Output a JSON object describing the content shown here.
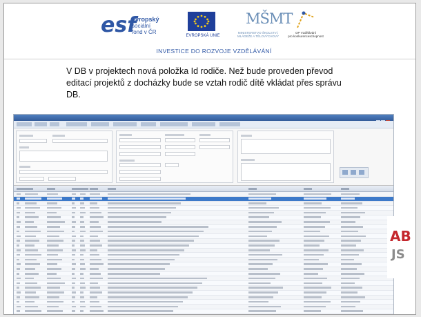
{
  "logos": {
    "esf_mark": "esf",
    "esf_line1": "evropský",
    "esf_line2": "sociální",
    "esf_line3": "fond v ČR",
    "eu_caption": "EVROPSKÁ UNIE",
    "msmt_mark": "MŠMT",
    "msmt_caption_1": "MINISTERSTVO ŠKOLSTVÍ,",
    "msmt_caption_2": "MLÁDEŽE A TĚLOVÝCHOVY",
    "op_caption_1": "OP Vzdělávání",
    "op_caption_2": "pro konkurenceschopnost",
    "tagline": "INVESTICE DO ROZVOJE VZDĚLÁVÁNÍ"
  },
  "note": {
    "text": "V DB v projektech nová položka Id rodiče. Než bude proveden převod editací projektů z docházky bude se vztah rodič dítě vkládat přes správu DB."
  },
  "screenshot": {
    "rows": 26,
    "selected_row": 1
  },
  "badge": {
    "line1": "AB",
    "line2": "JS"
  },
  "colors": {
    "brand_blue": "#2f57a5",
    "selection": "#3c79c9",
    "badge_red": "#c4272d"
  }
}
